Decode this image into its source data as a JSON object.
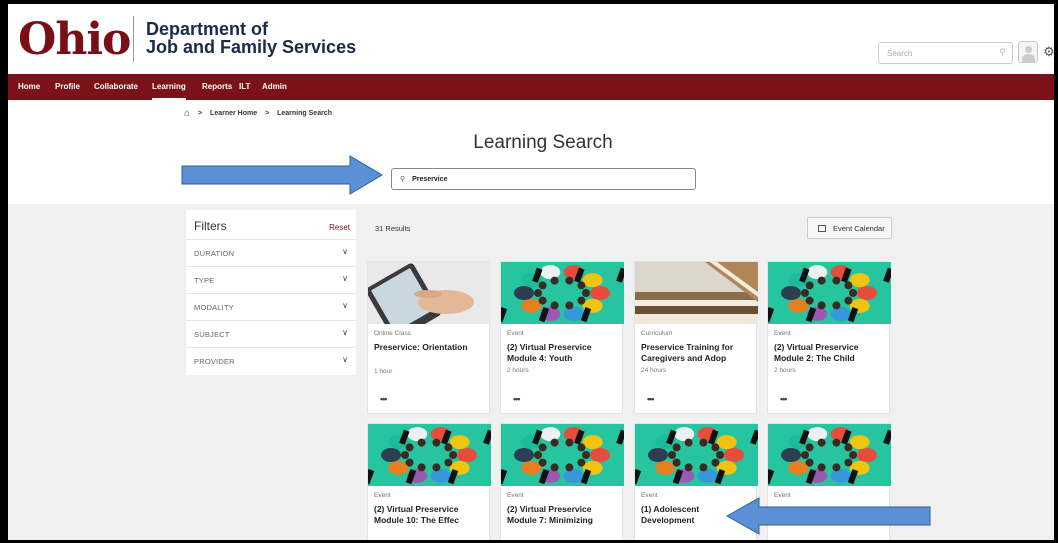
{
  "header": {
    "logo_text": "Ohio",
    "dept_line1": "Department of",
    "dept_line2": "Job and Family Services",
    "search_placeholder": "Search",
    "brand_color": "#7d1119"
  },
  "nav": {
    "items": [
      "Home",
      "Profile",
      "Collaborate",
      "Learning",
      "Reports",
      "ILT",
      "Admin"
    ],
    "active": "Learning"
  },
  "breadcrumb": {
    "items": [
      "Learner Home",
      "Learning Search"
    ]
  },
  "page": {
    "title": "Learning Search",
    "search_value": "Preservice"
  },
  "filters": {
    "title": "Filters",
    "reset_label": "Reset",
    "items": [
      "DURATION",
      "TYPE",
      "MODALITY",
      "SUBJECT",
      "PROVIDER"
    ]
  },
  "results": {
    "count_label": "31 Results",
    "event_calendar_label": "Event Calendar"
  },
  "cards": [
    {
      "type": "Online Class",
      "title": "Preservice: Orientation",
      "duration": "1 hour",
      "image": "tablet-hand"
    },
    {
      "type": "Event",
      "title": "(2) Virtual Preservice Module 4: Youth",
      "duration": "2 hours",
      "image": "people-circle"
    },
    {
      "type": "Curriculum",
      "title": "Preservice Training for Caregivers and Adop",
      "duration": "24 hours",
      "image": "books"
    },
    {
      "type": "Event",
      "title": "(2) Virtual Preservice Module 2: The Child",
      "duration": "2 hours",
      "image": "people-circle"
    },
    {
      "type": "Event",
      "title": "(2) Virtual Preservice Module 10: The Effec",
      "duration": "",
      "image": "people-circle"
    },
    {
      "type": "Event",
      "title": "(2) Virtual Preservice Module 7: Minimizing",
      "duration": "",
      "image": "people-circle"
    },
    {
      "type": "Event",
      "title": "(1) Adolescent Development",
      "duration": "",
      "image": "people-circle"
    },
    {
      "type": "Event",
      "title": "",
      "duration": "",
      "image": "people-circle"
    }
  ],
  "annotation_color": "#5b8fd6"
}
